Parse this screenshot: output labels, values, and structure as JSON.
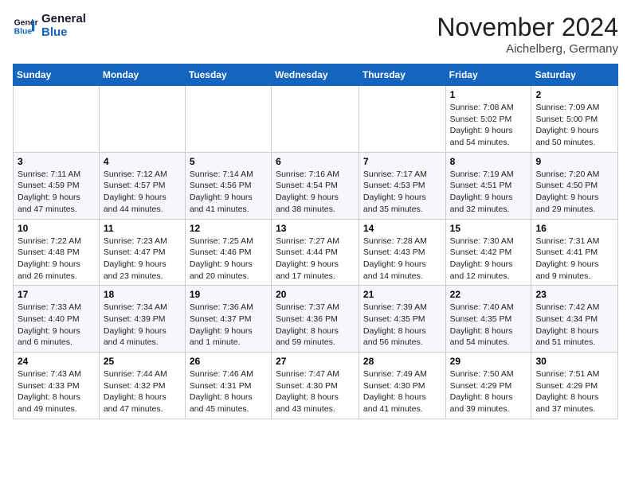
{
  "logo": {
    "line1": "General",
    "line2": "Blue"
  },
  "header": {
    "month": "November 2024",
    "location": "Aichelberg, Germany"
  },
  "weekdays": [
    "Sunday",
    "Monday",
    "Tuesday",
    "Wednesday",
    "Thursday",
    "Friday",
    "Saturday"
  ],
  "weeks": [
    [
      {
        "day": "",
        "info": ""
      },
      {
        "day": "",
        "info": ""
      },
      {
        "day": "",
        "info": ""
      },
      {
        "day": "",
        "info": ""
      },
      {
        "day": "",
        "info": ""
      },
      {
        "day": "1",
        "info": "Sunrise: 7:08 AM\nSunset: 5:02 PM\nDaylight: 9 hours and 54 minutes."
      },
      {
        "day": "2",
        "info": "Sunrise: 7:09 AM\nSunset: 5:00 PM\nDaylight: 9 hours and 50 minutes."
      }
    ],
    [
      {
        "day": "3",
        "info": "Sunrise: 7:11 AM\nSunset: 4:59 PM\nDaylight: 9 hours and 47 minutes."
      },
      {
        "day": "4",
        "info": "Sunrise: 7:12 AM\nSunset: 4:57 PM\nDaylight: 9 hours and 44 minutes."
      },
      {
        "day": "5",
        "info": "Sunrise: 7:14 AM\nSunset: 4:56 PM\nDaylight: 9 hours and 41 minutes."
      },
      {
        "day": "6",
        "info": "Sunrise: 7:16 AM\nSunset: 4:54 PM\nDaylight: 9 hours and 38 minutes."
      },
      {
        "day": "7",
        "info": "Sunrise: 7:17 AM\nSunset: 4:53 PM\nDaylight: 9 hours and 35 minutes."
      },
      {
        "day": "8",
        "info": "Sunrise: 7:19 AM\nSunset: 4:51 PM\nDaylight: 9 hours and 32 minutes."
      },
      {
        "day": "9",
        "info": "Sunrise: 7:20 AM\nSunset: 4:50 PM\nDaylight: 9 hours and 29 minutes."
      }
    ],
    [
      {
        "day": "10",
        "info": "Sunrise: 7:22 AM\nSunset: 4:48 PM\nDaylight: 9 hours and 26 minutes."
      },
      {
        "day": "11",
        "info": "Sunrise: 7:23 AM\nSunset: 4:47 PM\nDaylight: 9 hours and 23 minutes."
      },
      {
        "day": "12",
        "info": "Sunrise: 7:25 AM\nSunset: 4:46 PM\nDaylight: 9 hours and 20 minutes."
      },
      {
        "day": "13",
        "info": "Sunrise: 7:27 AM\nSunset: 4:44 PM\nDaylight: 9 hours and 17 minutes."
      },
      {
        "day": "14",
        "info": "Sunrise: 7:28 AM\nSunset: 4:43 PM\nDaylight: 9 hours and 14 minutes."
      },
      {
        "day": "15",
        "info": "Sunrise: 7:30 AM\nSunset: 4:42 PM\nDaylight: 9 hours and 12 minutes."
      },
      {
        "day": "16",
        "info": "Sunrise: 7:31 AM\nSunset: 4:41 PM\nDaylight: 9 hours and 9 minutes."
      }
    ],
    [
      {
        "day": "17",
        "info": "Sunrise: 7:33 AM\nSunset: 4:40 PM\nDaylight: 9 hours and 6 minutes."
      },
      {
        "day": "18",
        "info": "Sunrise: 7:34 AM\nSunset: 4:39 PM\nDaylight: 9 hours and 4 minutes."
      },
      {
        "day": "19",
        "info": "Sunrise: 7:36 AM\nSunset: 4:37 PM\nDaylight: 9 hours and 1 minute."
      },
      {
        "day": "20",
        "info": "Sunrise: 7:37 AM\nSunset: 4:36 PM\nDaylight: 8 hours and 59 minutes."
      },
      {
        "day": "21",
        "info": "Sunrise: 7:39 AM\nSunset: 4:35 PM\nDaylight: 8 hours and 56 minutes."
      },
      {
        "day": "22",
        "info": "Sunrise: 7:40 AM\nSunset: 4:35 PM\nDaylight: 8 hours and 54 minutes."
      },
      {
        "day": "23",
        "info": "Sunrise: 7:42 AM\nSunset: 4:34 PM\nDaylight: 8 hours and 51 minutes."
      }
    ],
    [
      {
        "day": "24",
        "info": "Sunrise: 7:43 AM\nSunset: 4:33 PM\nDaylight: 8 hours and 49 minutes."
      },
      {
        "day": "25",
        "info": "Sunrise: 7:44 AM\nSunset: 4:32 PM\nDaylight: 8 hours and 47 minutes."
      },
      {
        "day": "26",
        "info": "Sunrise: 7:46 AM\nSunset: 4:31 PM\nDaylight: 8 hours and 45 minutes."
      },
      {
        "day": "27",
        "info": "Sunrise: 7:47 AM\nSunset: 4:30 PM\nDaylight: 8 hours and 43 minutes."
      },
      {
        "day": "28",
        "info": "Sunrise: 7:49 AM\nSunset: 4:30 PM\nDaylight: 8 hours and 41 minutes."
      },
      {
        "day": "29",
        "info": "Sunrise: 7:50 AM\nSunset: 4:29 PM\nDaylight: 8 hours and 39 minutes."
      },
      {
        "day": "30",
        "info": "Sunrise: 7:51 AM\nSunset: 4:29 PM\nDaylight: 8 hours and 37 minutes."
      }
    ]
  ]
}
